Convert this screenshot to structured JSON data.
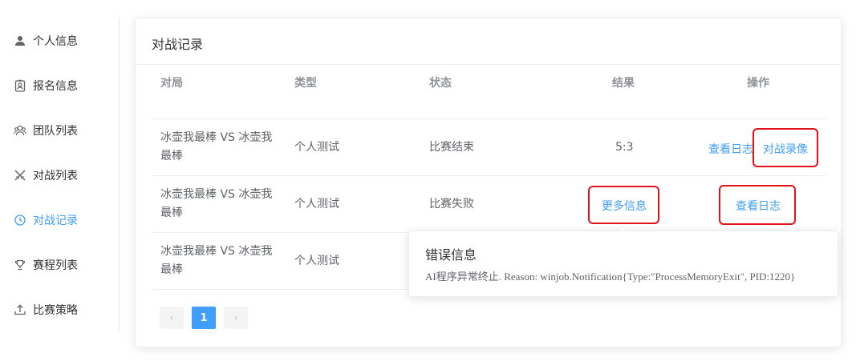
{
  "sidebar": {
    "items": [
      {
        "label": "个人信息",
        "icon": "user-icon",
        "active": false
      },
      {
        "label": "报名信息",
        "icon": "id-badge-icon",
        "active": false
      },
      {
        "label": "团队列表",
        "icon": "team-icon",
        "active": false
      },
      {
        "label": "对战列表",
        "icon": "crossed-swords-icon",
        "active": false
      },
      {
        "label": "对战记录",
        "icon": "clock-icon",
        "active": true
      },
      {
        "label": "赛程列表",
        "icon": "trophy-icon",
        "active": false
      },
      {
        "label": "比赛策略",
        "icon": "upload-icon",
        "active": false
      }
    ]
  },
  "card": {
    "title": "对战记录"
  },
  "table": {
    "columns": [
      "对局",
      "类型",
      "状态",
      "结果",
      "操作"
    ],
    "rows": [
      {
        "match_line1": "冰壶我最棒 VS 冰壶我",
        "match_line2": "最棒",
        "type": "个人测试",
        "status": "比赛结束",
        "result": "5:3",
        "actions": [
          "查看日志",
          "对战录像"
        ]
      },
      {
        "match_line1": "冰壶我最棒 VS 冰壶我",
        "match_line2": "最棒",
        "type": "个人测试",
        "status": "比赛失败",
        "result": "更多信息",
        "actions": [
          "查看日志"
        ]
      },
      {
        "match_line1": "冰壶我最棒 VS 冰壶我",
        "match_line2": "最棒",
        "type": "个人测试",
        "status": "",
        "result": "",
        "actions": []
      }
    ]
  },
  "pagination": {
    "prev": "‹",
    "current": "1",
    "next": "›"
  },
  "popover": {
    "title": "错误信息",
    "content": "AI程序异常终止. Reason: winjob.Notification{Type:\"ProcessMemoryExit\", PID:1220}"
  },
  "colors": {
    "accent": "#409eff",
    "annotation": "#e3131d",
    "text": "#606266",
    "header_text": "#909399"
  }
}
